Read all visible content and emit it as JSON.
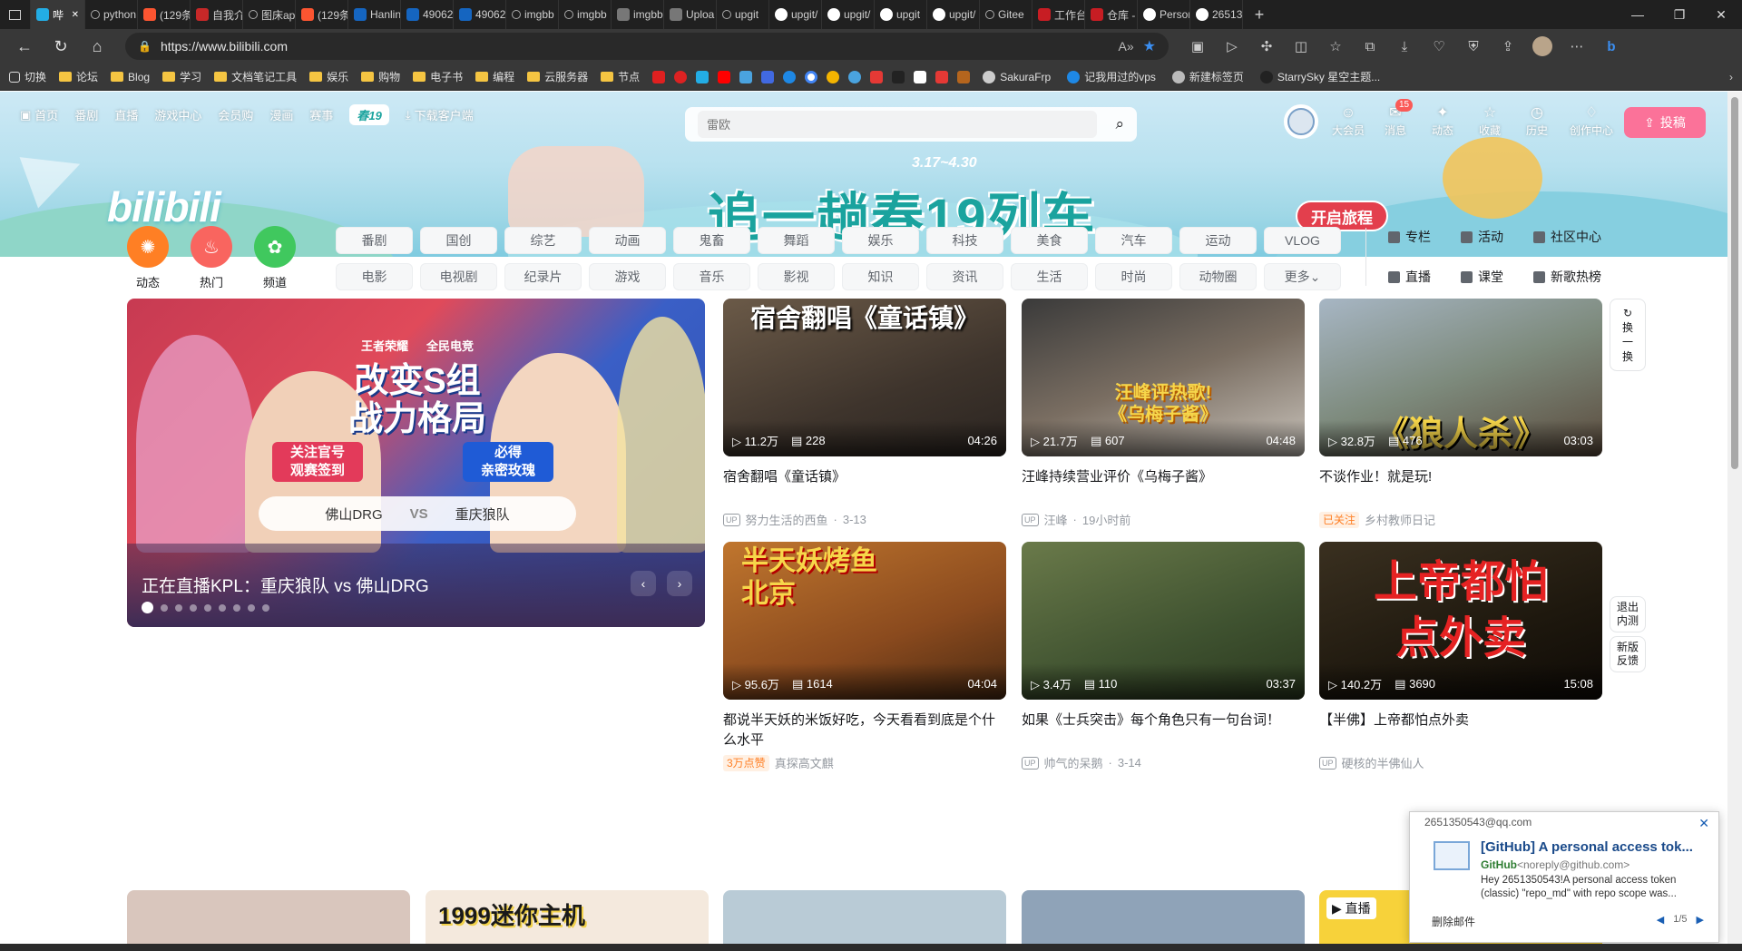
{
  "browser": {
    "tabs": [
      {
        "label": "哔",
        "icon": "bili",
        "active": true
      },
      {
        "label": "python",
        "icon": "search"
      },
      {
        "label": "(129条",
        "icon": "csdn"
      },
      {
        "label": "自我介",
        "icon": "doc"
      },
      {
        "label": "图床ap",
        "icon": "search"
      },
      {
        "label": "(129条",
        "icon": "csdn"
      },
      {
        "label": "Hanlin",
        "icon": "imgbb"
      },
      {
        "label": "49062",
        "icon": "imgbb"
      },
      {
        "label": "49062",
        "icon": "imgbb"
      },
      {
        "label": "imgbb",
        "icon": "search"
      },
      {
        "label": "imgbb",
        "icon": "search"
      },
      {
        "label": "imgbb",
        "icon": "gray"
      },
      {
        "label": "Uploa",
        "icon": "gray"
      },
      {
        "label": "upgit",
        "icon": "search"
      },
      {
        "label": "upgit/",
        "icon": "github"
      },
      {
        "label": "upgit/",
        "icon": "github"
      },
      {
        "label": "upgit",
        "icon": "google"
      },
      {
        "label": "upgit/",
        "icon": "github"
      },
      {
        "label": "Gitee",
        "icon": "search"
      },
      {
        "label": "工作台",
        "icon": "gitee"
      },
      {
        "label": "仓库 -",
        "icon": "gitee"
      },
      {
        "label": "Persor",
        "icon": "github"
      },
      {
        "label": "26513",
        "icon": "github"
      }
    ],
    "url": "https://www.bilibili.com",
    "bookmarks": [
      "切换",
      "论坛",
      "Blog",
      "学习",
      "文档笔记工具",
      "娱乐",
      "购物",
      "电子书",
      "编程",
      "云服务器",
      "节点"
    ],
    "bookmarks_right": [
      "SakuraFrp",
      "记我用过的vps",
      "新建标签页",
      "StarrySky 星空主题..."
    ]
  },
  "header": {
    "nav": [
      "首页",
      "番剧",
      "直播",
      "游戏中心",
      "会员购",
      "漫画",
      "赛事"
    ],
    "chun19": "春19",
    "download": "下载客户端",
    "search_placeholder": "雷欧",
    "right_nav": [
      {
        "label": "大会员",
        "icon": "vip-icon"
      },
      {
        "label": "消息",
        "icon": "message-icon",
        "badge": "15"
      },
      {
        "label": "动态",
        "icon": "dynamic-icon"
      },
      {
        "label": "收藏",
        "icon": "star-icon"
      },
      {
        "label": "历史",
        "icon": "history-icon"
      },
      {
        "label": "创作中心",
        "icon": "bulb-icon"
      }
    ],
    "upload": "投稿",
    "logo": "bilibili",
    "banner_dates": "3.17~4.30",
    "banner_slogan": "追一趟春19列车",
    "banner_button": "开启旅程"
  },
  "quick": [
    {
      "label": "动态",
      "color": "#ff7f24"
    },
    {
      "label": "热门",
      "color": "#f9655f"
    },
    {
      "label": "频道",
      "color": "#40c85e"
    }
  ],
  "channels": [
    "番剧",
    "国创",
    "综艺",
    "动画",
    "鬼畜",
    "舞蹈",
    "娱乐",
    "科技",
    "美食",
    "汽车",
    "运动",
    "VLOG",
    "电影",
    "电视剧",
    "纪录片",
    "游戏",
    "音乐",
    "影视",
    "知识",
    "资讯",
    "生活",
    "时尚",
    "动物圈",
    "更多"
  ],
  "side_links": [
    "专栏",
    "活动",
    "社区中心",
    "直播",
    "课堂",
    "新歌热榜"
  ],
  "carousel": {
    "title": "正在直播KPL：重庆狼队 vs 佛山DRG",
    "game": "王者荣耀",
    "event": "全民电竞",
    "headline1": "改变S组",
    "headline2": "战力格局",
    "promo1": "关注官号\n观赛签到",
    "promo2": "必得\n亲密玫瑰",
    "team_a": "佛山DRG",
    "vs": "VS",
    "team_b": "重庆狼队",
    "slides": 9,
    "active_slide": 1
  },
  "videos": [
    {
      "thumb_text": "宿舍翻唱《童话镇》",
      "views": "11.2万",
      "danmaku": "228",
      "duration": "04:26",
      "title": "宿舍翻唱《童话镇》",
      "author": "努力生活的西鱼",
      "date": "3-13"
    },
    {
      "thumb_text": "汪峰评热歌!\n《乌梅子酱》",
      "views": "21.7万",
      "danmaku": "607",
      "duration": "04:48",
      "title": "汪峰持续营业评价《乌梅子酱》",
      "author": "汪峰",
      "date": "19小时前"
    },
    {
      "thumb_text": "《狼人杀》",
      "views": "32.8万",
      "danmaku": "476",
      "duration": "03:03",
      "title": "不谈作业！就是玩!",
      "tag": "已关注",
      "author": "乡村教师日记",
      "date": ""
    },
    {
      "thumb_text": "半天妖烤鱼\n北京",
      "views": "95.6万",
      "danmaku": "1614",
      "duration": "04:04",
      "title": "都说半天妖的米饭好吃，今天看看到底是个什么水平",
      "tag": "3万点赞",
      "author": "真探高文麒",
      "date": ""
    },
    {
      "thumb_text": "",
      "views": "3.4万",
      "danmaku": "110",
      "duration": "03:37",
      "title": "如果《士兵突击》每个角色只有一句台词！",
      "author": "帅气的呆鹅",
      "date": "3-14"
    },
    {
      "thumb_text": "上帝都怕\n点外卖",
      "views": "140.2万",
      "danmaku": "3690",
      "duration": "15:08",
      "title": "【半佛】上帝都怕点外卖",
      "author": "硬核的半佛仙人",
      "date": ""
    }
  ],
  "refresh": "换一换",
  "side_buttons": [
    "退出内测",
    "新版反馈"
  ],
  "bottom_row": {
    "card2_text": "1999迷你主机",
    "card5_tag": "直播"
  },
  "notification": {
    "account": "2651350543@qq.com",
    "subject": "[GitHub] A personal access tok...",
    "sender": "GitHub",
    "sender_email": "<noreply@github.com>",
    "body": "Hey 2651350543!A personal access token (classic) \"repo_md\" with repo scope was...",
    "delete": "删除邮件",
    "pager": "1/5"
  }
}
